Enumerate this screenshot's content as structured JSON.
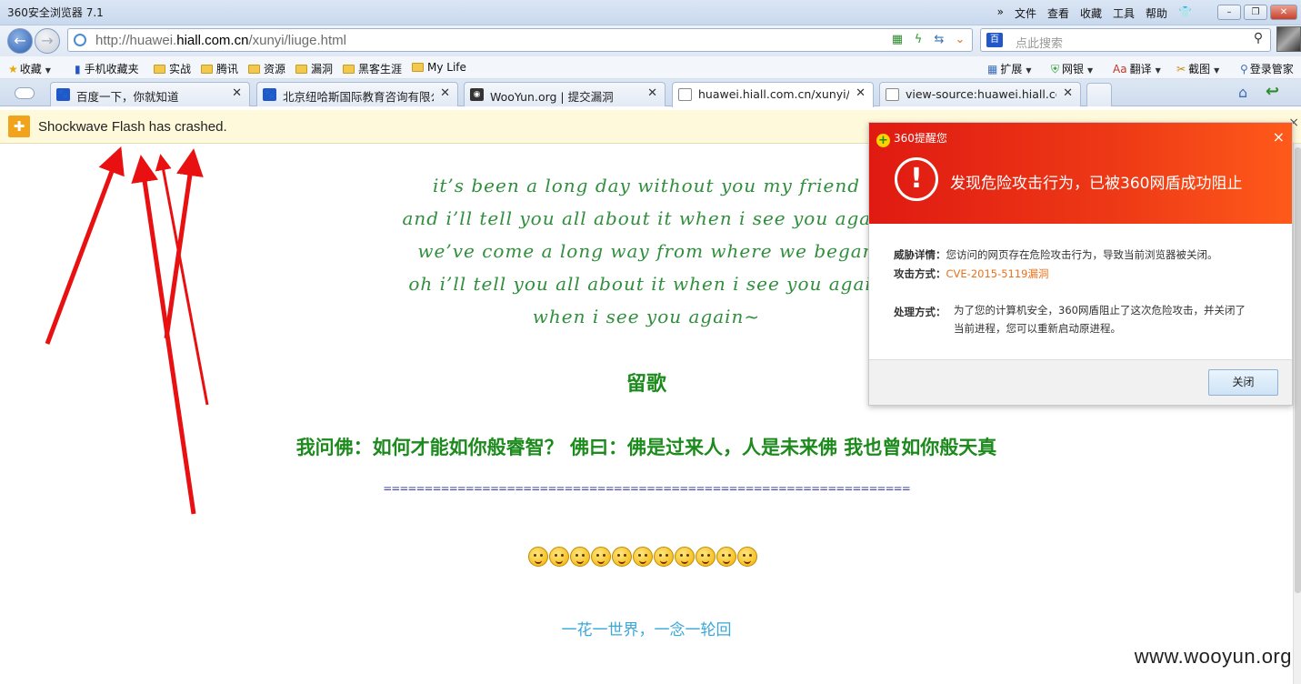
{
  "window": {
    "title": "360安全浏览器 7.1",
    "menu_overflow": "»",
    "menus": [
      "文件",
      "查看",
      "收藏",
      "工具",
      "帮助"
    ],
    "shirt_icon": "shirt-icon"
  },
  "nav": {
    "url_prefix": "http://huawei.",
    "url_domain": "hiall.com.cn",
    "url_path": "/xunyi/liuge.html",
    "search_placeholder": "点此搜索",
    "search_engine_label": "百"
  },
  "favorites": {
    "collect_label": "收藏",
    "items": [
      "手机收藏夹",
      "实战",
      "腾讯",
      "资源",
      "漏洞",
      "黑客生涯",
      "My Life"
    ],
    "right_tools": [
      "扩展",
      "网银",
      "翻译",
      "截图",
      "登录管家"
    ]
  },
  "tabs": [
    {
      "label": "百度一下，你就知道",
      "icon": "baidu-icon"
    },
    {
      "label": "北京纽哈斯国际教育咨询有限公司",
      "icon": "baidu-icon"
    },
    {
      "label": "WooYun.org | 提交漏洞",
      "icon": "wooyun-icon"
    },
    {
      "label": "huawei.hiall.com.cn/xunyi/liuge.html",
      "icon": "page-icon"
    },
    {
      "label": "view-source:huawei.hiall.com.cn",
      "icon": "page-icon"
    }
  ],
  "crash": {
    "message": "Shockwave Flash has crashed.",
    "close": "×"
  },
  "page": {
    "lyrics": [
      "it’s been a long day without you my friend",
      "and i’ll tell you all about it when i see you again",
      "we’ve come a long way from where we began",
      "oh i’ll tell you all about it when i see you again",
      "when i see you again~"
    ],
    "song_title": "留歌",
    "quote": "我问佛：如何才能如你般睿智？ 佛曰：佛是过来人，人是未来佛 我也曾如你般天真",
    "divider": "================================================================",
    "emoji_count": 11,
    "motto": "一花一世界，一念一轮回"
  },
  "popup": {
    "brand": "360提醒您",
    "close_x": "×",
    "headline": "发现危险攻击行为，已被360网盾成功阻止",
    "details_label": "威胁详情：",
    "details_value": "您访问的网页存在危险攻击行为，导致当前浏览器被关闭。",
    "attack_label": "攻击方式：",
    "attack_value": "CVE-2015-5119漏洞",
    "handle_label": "处理方式：",
    "handle_value": "为了您的计算机安全，360网盾阻止了这次危险攻击，并关闭了当前进程，您可以重新启动原进程。",
    "close_button": "关闭"
  },
  "watermark": "www.wooyun.org",
  "colors": {
    "popup_red": "#e01a12",
    "lyric_green": "#2f8f3c",
    "motto_blue": "#3aa7d8",
    "cve_orange": "#e8711b",
    "arrow_red": "#e81010"
  }
}
